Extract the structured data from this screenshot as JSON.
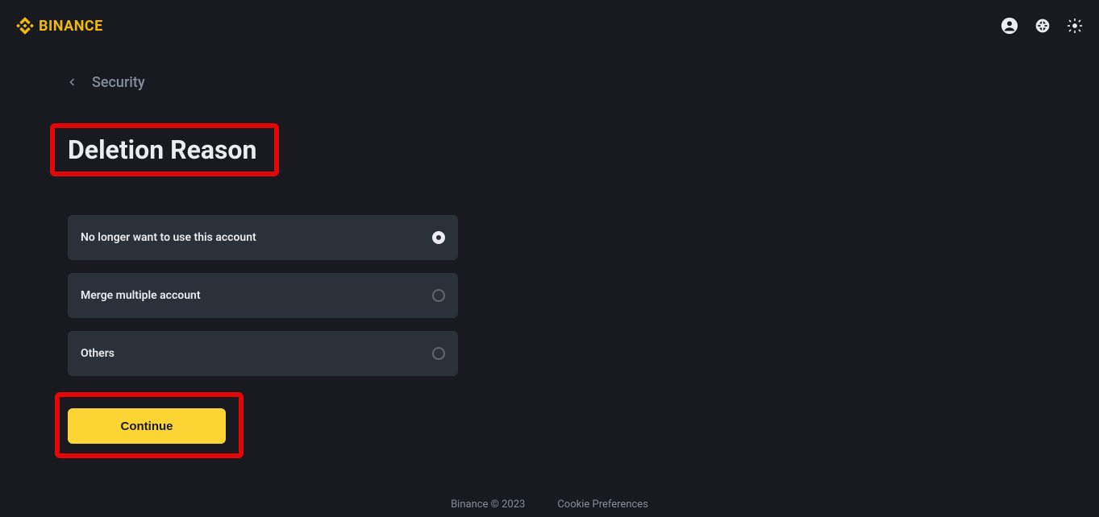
{
  "header": {
    "brand": "BINANCE"
  },
  "breadcrumb": {
    "label": "Security"
  },
  "page": {
    "title": "Deletion Reason"
  },
  "options": [
    {
      "label": "No longer want to use this account",
      "selected": true
    },
    {
      "label": "Merge multiple account",
      "selected": false
    },
    {
      "label": "Others",
      "selected": false
    }
  ],
  "actions": {
    "continue": "Continue"
  },
  "footer": {
    "copyright": "Binance © 2023",
    "cookie": "Cookie Preferences"
  }
}
